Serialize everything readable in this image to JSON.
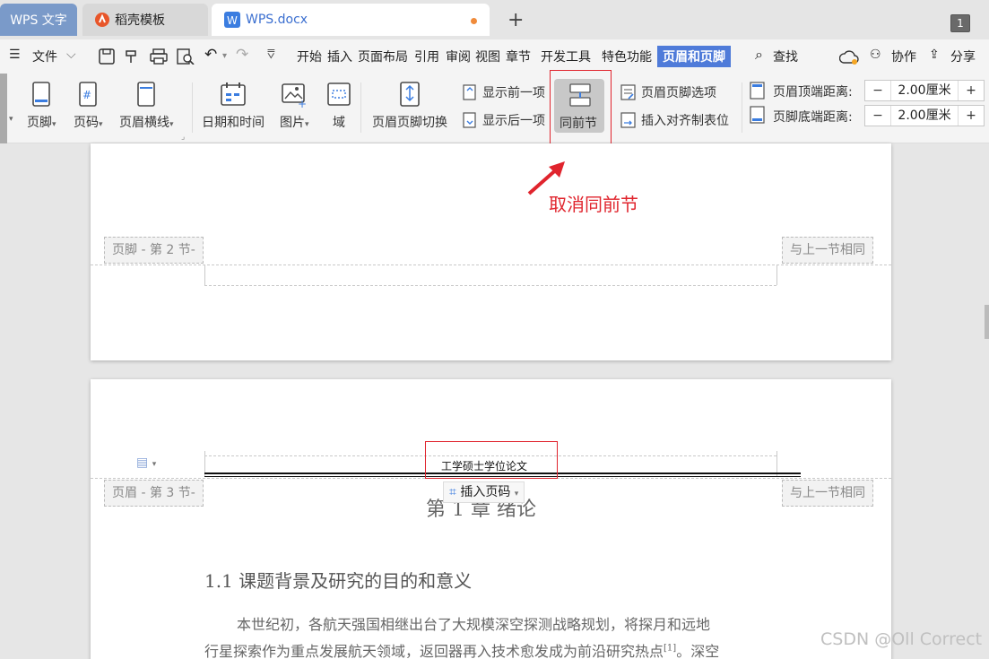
{
  "tabs": {
    "app": "WPS 文字",
    "template": "稻壳模板",
    "doc": "WPS.docx",
    "add": "+",
    "window_count": "1"
  },
  "menu": {
    "file": "文件",
    "items": [
      "开始",
      "插入",
      "页面布局",
      "引用",
      "审阅",
      "视图",
      "章节",
      "开发工具",
      "特色功能"
    ],
    "active": "页眉和页脚",
    "search": "查找",
    "collab": "协作",
    "share": "分享"
  },
  "ribbon": {
    "footer": "页脚",
    "page_number": "页码",
    "header_line": "页眉横线",
    "date_time": "日期和时间",
    "picture": "图片",
    "field": "域",
    "switch": "页眉页脚切换",
    "show_prev": "显示前一项",
    "show_next": "显示后一项",
    "same_as_prev": "同前节",
    "hf_options": "页眉页脚选项",
    "insert_tab": "插入对齐制表位",
    "header_top_label": "页眉顶端距离:",
    "header_top_value": "2.00厘米",
    "footer_bottom_label": "页脚底端距离:",
    "footer_bottom_value": "2.00厘米",
    "minus": "−",
    "plus": "+"
  },
  "document": {
    "footer_tag": "页脚 - 第 2 节-",
    "same_prev_tag": "与上一节相同",
    "header_tag": "页眉 - 第 3 节-",
    "same_prev_tag2": "与上一节相同",
    "header_text": "工学硕士学位论文",
    "insert_page_number": "插入页码",
    "chapter_title": "第 1 章  绪论",
    "section_title": "1.1  课题背景及研究的目的和意义",
    "para1": "本世纪初，各航天强国相继出台了大规模深空探测战略规划，将探月和远地",
    "para2": "行星探索作为重点发展航天领域，返回器再入技术愈发成为前沿研究热点",
    "para2_ref": "[1]",
    "para2_tail": "。深空"
  },
  "annotation": "取消同前节",
  "watermark": "CSDN @Oll Correct",
  "colors": {
    "accent": "#4f7bd9",
    "annotation": "#e0242d"
  }
}
